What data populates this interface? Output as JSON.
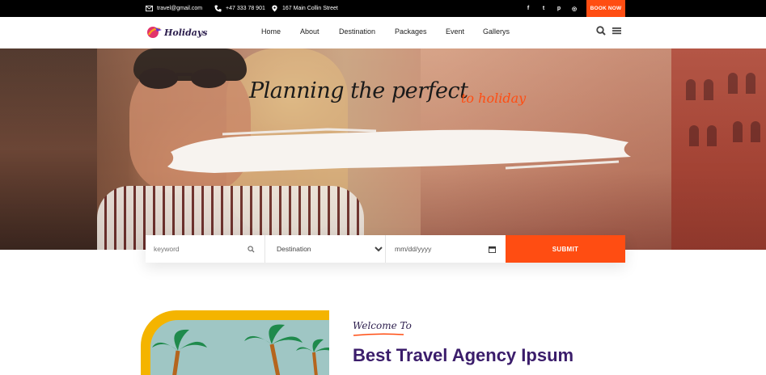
{
  "topbar": {
    "email": "travel@gmail.com",
    "phone": "+47 333 78 901",
    "address": "167 Main Collin Street",
    "email_icon": "mail-icon",
    "phone_icon": "phone-icon",
    "address_icon": "map-pin-icon",
    "social": [
      {
        "icon": "facebook-icon",
        "glyph": "f"
      },
      {
        "icon": "twitter-icon",
        "glyph": "t"
      },
      {
        "icon": "pinterest-icon",
        "glyph": "p"
      },
      {
        "icon": "instagram-icon",
        "glyph": "◎"
      }
    ],
    "book_label": "BOOK NOW"
  },
  "nav": {
    "logo_text": "Holidays",
    "links": [
      "Home",
      "About",
      "Destination",
      "Packages",
      "Event",
      "Gallerys"
    ],
    "search_icon": "search-icon",
    "menu_icon": "hamburger-menu-icon"
  },
  "hero": {
    "headline": "Planning the perfect",
    "headline_accent": "to holiday"
  },
  "search": {
    "keyword_placeholder": "keyword",
    "destination_selected": "Destination",
    "date_placeholder": "mm/dd/yyyy",
    "submit_label": "SUBMIT"
  },
  "welcome": {
    "label": "Welcome To",
    "title": "Best Travel Agency Ipsum"
  },
  "colors": {
    "accent": "#ff4d12",
    "brand_purple": "#3b1d6b",
    "topbar_bg": "#000000",
    "frame_yellow": "#f4b400"
  }
}
